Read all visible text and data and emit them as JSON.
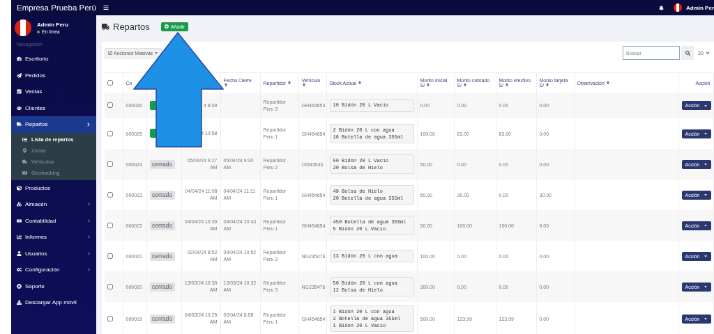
{
  "app": {
    "brand": "Empresa Prueba Perú",
    "user": "Admin Per"
  },
  "sidebar": {
    "user": {
      "name": "Admin Peru",
      "status": "En línea"
    },
    "section": "Navegación",
    "items": [
      {
        "label": "Escritorio",
        "selected": false
      },
      {
        "label": "Pedidos",
        "selected": false
      },
      {
        "label": "Ventas",
        "selected": false
      },
      {
        "label": "Clientes",
        "selected": false
      },
      {
        "label": "Repartos",
        "selected": true,
        "expanded": true,
        "children": [
          {
            "label": "Lista de repartos",
            "selected": true
          },
          {
            "label": "Zonas",
            "selected": false
          },
          {
            "label": "Vehículos",
            "selected": false
          },
          {
            "label": "Geotracking",
            "selected": false
          }
        ]
      },
      {
        "label": "Productos",
        "selected": false
      },
      {
        "label": "Almacén",
        "selected": false,
        "expanded": false
      },
      {
        "label": "Contabilidad",
        "selected": false,
        "expanded": false
      },
      {
        "label": "Informes",
        "selected": false,
        "expanded": false
      },
      {
        "label": "Usuarios",
        "selected": false,
        "expanded": false
      },
      {
        "label": "Configuración",
        "selected": false,
        "expanded": false
      },
      {
        "label": "Soporte",
        "selected": false
      },
      {
        "label": "Descargar App móvil",
        "selected": false
      }
    ]
  },
  "page": {
    "title": "Repartos",
    "add_button": "Añadir",
    "bulk_button": "Acciones Masivas",
    "search": {
      "placeholder": "Buscar"
    },
    "page_size": "20"
  },
  "table": {
    "select_all_checked": false,
    "columns": [
      "Co",
      "",
      "Fecha Cierre",
      "Repartidor",
      "Vehículo",
      "Stock Actual",
      "Monto inicial S/",
      "Monto cobrado S/",
      "Monto efectivo S/",
      "Monto tarjeta S/",
      "Observación",
      "Acción"
    ],
    "rows": [
      {
        "checked": false,
        "code": "000026",
        "status": {
          "kind": "open"
        },
        "opened": "4 8:09",
        "driver": "Repartidor Peru 3",
        "vehicle": "GH454654",
        "stock": [
          "10 Bidón 20 L Vacío"
        ],
        "initial": "0.00",
        "collected": "0.00",
        "cash": "0.00",
        "card": "0.00",
        "action": "Acción"
      },
      {
        "checked": false,
        "code": "000025",
        "status": {
          "kind": "open"
        },
        "opened": "4 10:58",
        "driver": "Repartidor Peru 1",
        "vehicle": "GH454654",
        "stock": [
          "2 Bidón 20 L con agua",
          "16 Botella de agua 355ml"
        ],
        "initial": "100.00",
        "collected": "83.00",
        "cash": "83.00",
        "card": "0.00",
        "action": "Acción"
      },
      {
        "checked": false,
        "code": "000024",
        "status": {
          "kind": "closed",
          "label": "cerrado"
        },
        "opened": "05/04/24 9:27 AM",
        "closed": "05/04/24 9:30 AM",
        "driver": "Repartidor Peru 2",
        "vehicle": "OI543543",
        "stock": [
          "50 Bidón 20 L Vacío",
          "20 Bolsa de Hielo"
        ],
        "initial": "50.00",
        "collected": "0.00",
        "cash": "0.00",
        "card": "0.00",
        "action": "Acción"
      },
      {
        "checked": false,
        "code": "000023",
        "status": {
          "kind": "closed",
          "label": "cerrado"
        },
        "opened": "04/04/24 11:08 AM",
        "closed": "04/04/24 11:11 AM",
        "driver": "Repartidor Peru 1",
        "vehicle": "GH454654",
        "stock": [
          "49 Bolsa de Hielo",
          "20 Botella de agua 355ml"
        ],
        "initial": "50.00",
        "collected": "30.00",
        "cash": "0.00",
        "card": "30.00",
        "action": "Acción"
      },
      {
        "checked": false,
        "code": "000022",
        "status": {
          "kind": "closed",
          "label": "cerrado"
        },
        "opened": "04/04/24 10:39 AM",
        "closed": "04/04/24 10:43 AM",
        "driver": "Repartidor Peru 1",
        "vehicle": "GH454654",
        "stock": [
          "450 Botella de agua 355ml",
          "5 Bidón 20 L Vacío"
        ],
        "initial": "50.00",
        "collected": "100.00",
        "cash": "100.00",
        "card": "0.00",
        "action": "Acción"
      },
      {
        "checked": false,
        "code": "000021",
        "status": {
          "kind": "closed",
          "label": "cerrado"
        },
        "opened": "02/04/24 8:52 AM",
        "closed": "09/04/24 10:52 AM",
        "driver": "Repartidor Peru 3",
        "vehicle": "NG235476",
        "stock": [
          "13 Bidón 20 L con agua"
        ],
        "initial": "100.00",
        "collected": "0.00",
        "cash": "0.00",
        "card": "0.00",
        "action": "Acción"
      },
      {
        "checked": false,
        "code": "000020",
        "status": {
          "kind": "closed",
          "label": "cerrado"
        },
        "opened": "13/03/24 10:30 AM",
        "closed": "13/03/24 10:32 AM",
        "driver": "Repartidor Peru 3",
        "vehicle": "NG235476",
        "stock": [
          "50 Bidón 20 L con agua",
          "12 Bolsa de Hielo"
        ],
        "initial": "300.00",
        "collected": "0.00",
        "cash": "0.00",
        "card": "0.00",
        "action": "Acción"
      },
      {
        "checked": false,
        "code": "000019",
        "status": {
          "kind": "closed",
          "label": "cerrado"
        },
        "opened": "04/03/24 10:25 AM",
        "closed": "02/04/24 8:58 AM",
        "driver": "Repartidor Peru 1",
        "vehicle": "GH454654",
        "stock": [
          "1 Bidón 20 L con agua",
          "2 Botella de agua 355ml",
          "1 Bidón 20 L Vacío"
        ],
        "initial": "500.00",
        "collected": "123.99",
        "cash": "123.99",
        "card": "0.00",
        "action": "Acción"
      }
    ]
  }
}
